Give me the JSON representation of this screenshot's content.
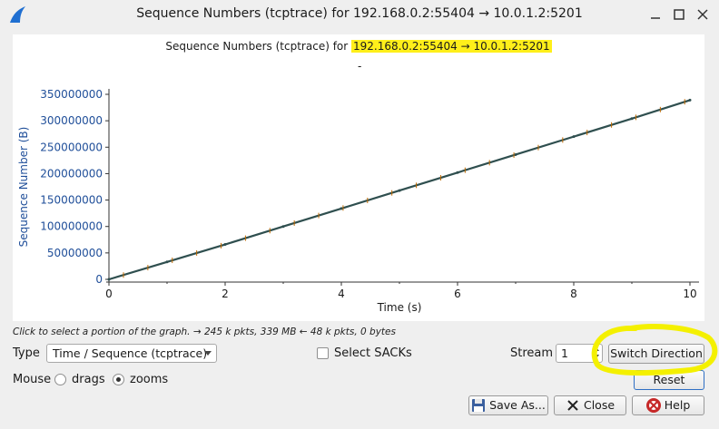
{
  "window": {
    "title": "Sequence Numbers (tcptrace) for 192.168.0.2:55404 → 10.0.1.2:5201"
  },
  "graph": {
    "title_prefix": "Sequence Numbers (tcptrace) for ",
    "title_highlight": "192.168.0.2:55404 → 10.0.1.2:5201",
    "subtitle": "-"
  },
  "chart_data": {
    "type": "line",
    "title": "Sequence Numbers (tcptrace) for 192.168.0.2:55404 → 10.0.1.2:5201",
    "xlabel": "Time (s)",
    "ylabel": "Sequence Number (B)",
    "xlim": [
      0,
      10
    ],
    "ylim": [
      0,
      350000000
    ],
    "x_ticks": [
      0,
      2,
      4,
      6,
      8,
      10
    ],
    "y_ticks": [
      0,
      50000000,
      100000000,
      150000000,
      200000000,
      250000000,
      300000000,
      350000000
    ],
    "grid": false,
    "series": [
      {
        "x": [
          0,
          1,
          2,
          3,
          4,
          5,
          6,
          7,
          8,
          9,
          10
        ],
        "values": [
          0,
          33000000,
          66000000,
          100000000,
          134000000,
          168000000,
          202000000,
          236000000,
          270000000,
          304000000,
          339000000
        ]
      }
    ],
    "colors": {
      "line": "#2f4f4f",
      "marks": "#c06a00",
      "axis_text": "#1f4e99"
    }
  },
  "hint": "Click to select a portion of the graph. → 245 k pkts, 339 MB ← 48 k pkts, 0 bytes",
  "controls": {
    "type_label": "Type",
    "type_value": "Time / Sequence (tcptrace)",
    "select_sacks_label": "Select SACKs",
    "stream_label": "Stream",
    "stream_value": "1",
    "switch_direction_label": "Switch Direction",
    "mouse_label": "Mouse",
    "drags_label": "drags",
    "zooms_label": "zooms",
    "reset_label": "Reset",
    "save_label": "Save As...",
    "close_label": "Close",
    "help_label": "Help"
  }
}
